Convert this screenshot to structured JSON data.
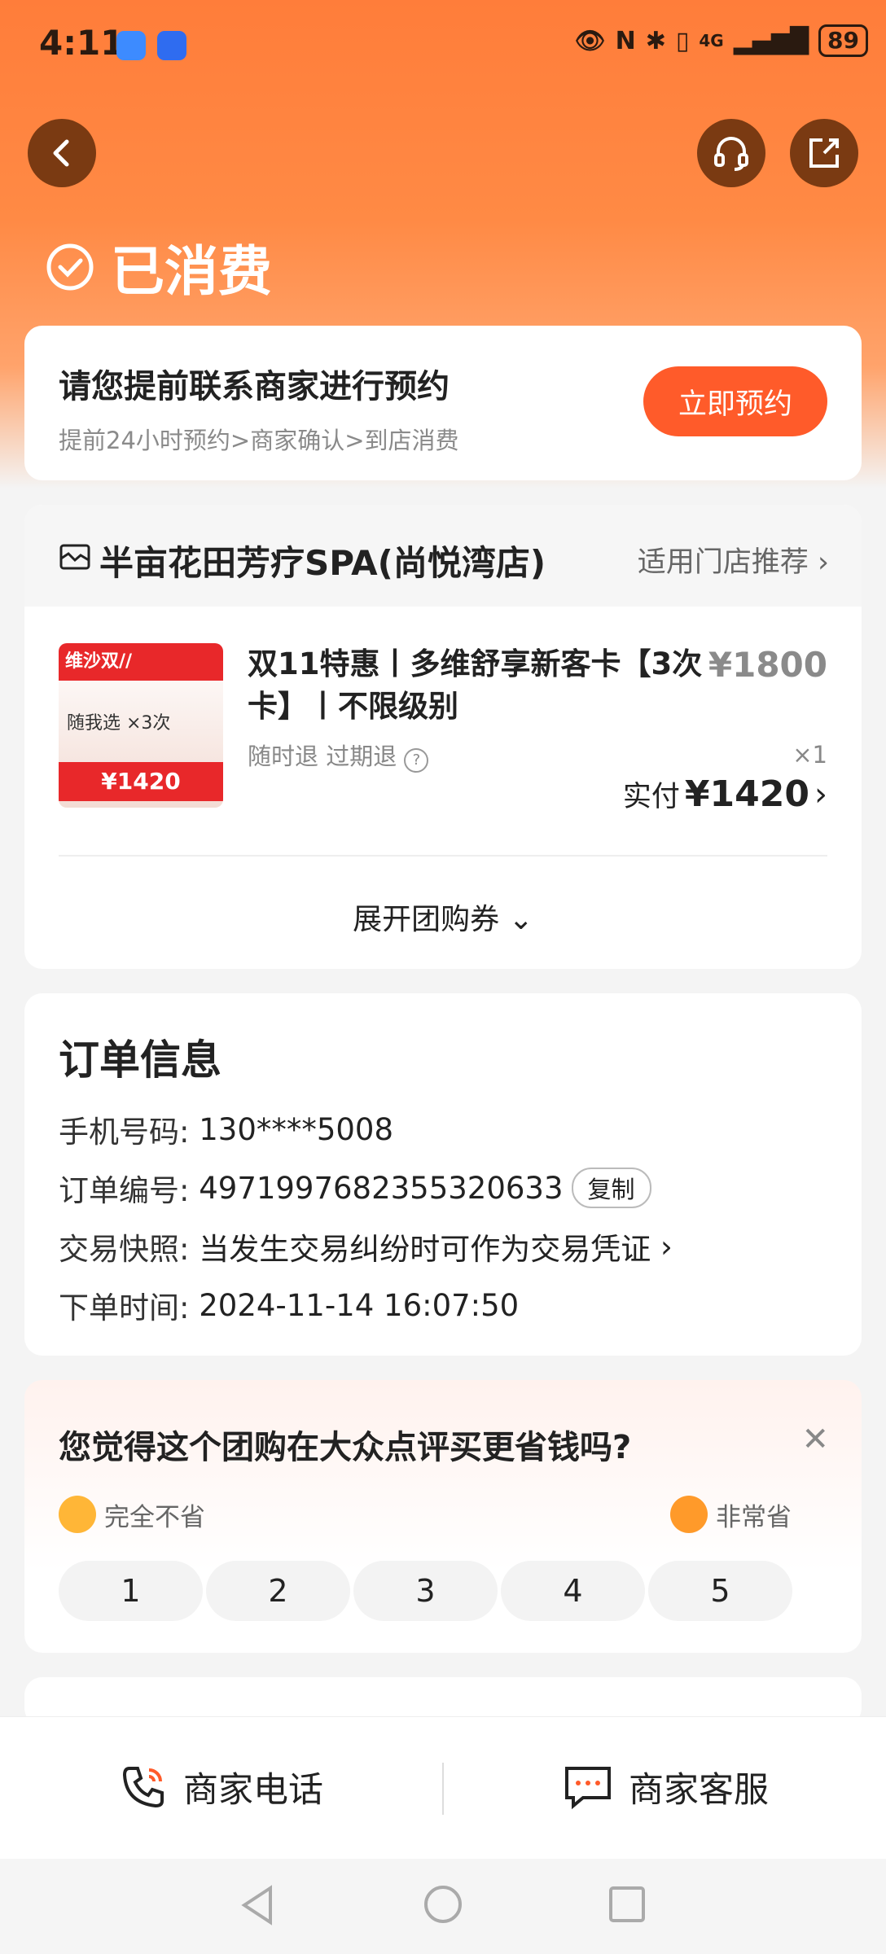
{
  "status": {
    "time": "4:11",
    "network": "4G",
    "battery": "89"
  },
  "header": {
    "title": "已消费"
  },
  "booking": {
    "title": "请您提前联系商家进行预约",
    "subtitle": "提前24小时预约>商家确认>到店消费",
    "button": "立即预约"
  },
  "shop": {
    "name": "半亩花田芳疗SPA(尚悦湾店)",
    "recommend": "适用门店推荐",
    "product": {
      "title": "双11特惠丨多维舒享新客卡【3次卡】丨不限级别",
      "price": "¥1800",
      "tags": "随时退 过期退",
      "qty": "×1",
      "paid_label": "实付",
      "paid_value": "¥1420",
      "thumb_ribbon": "维沙双//",
      "thumb_mid": "随我选 ×3次",
      "thumb_price": "¥1420"
    },
    "expand": "展开团购券"
  },
  "order": {
    "title": "订单信息",
    "rows": [
      {
        "key": "手机号码:",
        "value": "130****5008"
      },
      {
        "key": "订单编号:",
        "value": "4971997682355320633"
      },
      {
        "key": "交易快照:",
        "value": "当发生交易纠纷时可作为交易凭证"
      },
      {
        "key": "下单时间:",
        "value": "2024-11-14 16:07:50"
      }
    ],
    "copy": "复制"
  },
  "survey": {
    "question": "您觉得这个团购在大众点评买更省钱吗?",
    "left_label": "完全不省",
    "right_label": "非常省",
    "ratings": [
      "1",
      "2",
      "3",
      "4",
      "5"
    ]
  },
  "bottom": {
    "phone": "商家电话",
    "service": "商家客服"
  }
}
